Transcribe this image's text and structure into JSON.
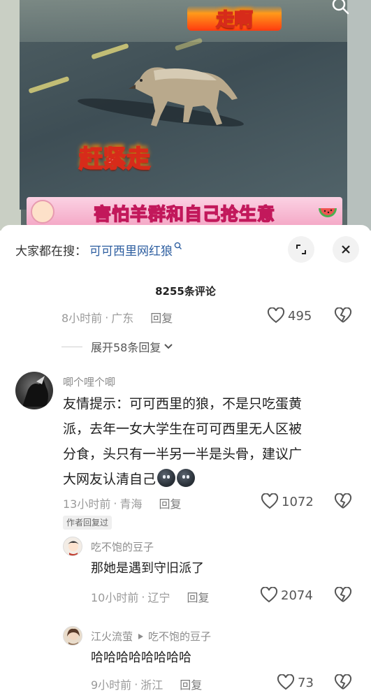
{
  "video": {
    "caption_top": "走啊",
    "caption_mid": "赶紧走",
    "banner": "害怕羊群和自己抢生意",
    "search_icon": "search-icon"
  },
  "search_bar": {
    "prefix": "大家都在搜：",
    "keyword": "可可西里网红狼",
    "keyword_icon": "search-icon"
  },
  "comments_header": {
    "count_label": "8255条评论"
  },
  "top_comment_tail": {
    "time": "8小时前",
    "separator": "·",
    "location": "广东",
    "reply_label": "回复",
    "likes": "495"
  },
  "expand_replies": {
    "label": "展开58条回复",
    "icon": "chevron-down-icon"
  },
  "comments": [
    {
      "username": "唧个哩个唧",
      "text_lines": [
        "友情提示：可可西里的狼，不是只吃蛋黄",
        "派，去年一女大学生在可可西里无人区被",
        "分食，头只有一半另一半是头骨，建议广",
        "大网友认清自己"
      ],
      "emoji_count": 2,
      "time": "13小时前",
      "separator": "·",
      "location": "青海",
      "reply_label": "回复",
      "likes": "1072",
      "badge": "作者回复过"
    }
  ],
  "replies": [
    {
      "username": "吃不饱的豆子",
      "text": "那她是遇到守旧派了",
      "time": "10小时前",
      "separator": "·",
      "location": "辽宁",
      "reply_label": "回复",
      "likes": "2074"
    },
    {
      "username": "江火流萤",
      "reply_to": "吃不饱的豆子",
      "text": "哈哈哈哈哈哈哈哈",
      "time": "9小时前",
      "separator": "·",
      "location": "浙江",
      "reply_label": "回复",
      "likes": "73"
    }
  ],
  "colors": {
    "link_blue": "#2d5ea0",
    "meta_gray": "#9a9a9a",
    "banner_pink": "#f4a8c6"
  }
}
